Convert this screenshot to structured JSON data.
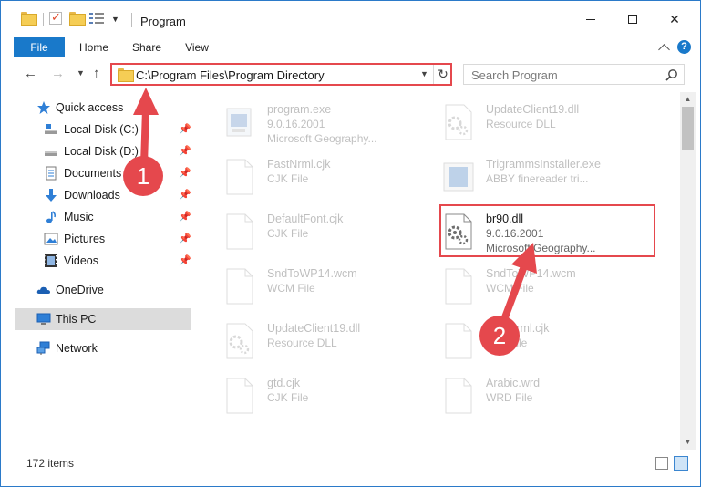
{
  "window": {
    "title": "Program",
    "colors": {
      "accent": "#1979ca",
      "annotation": "#e5484d",
      "selection": "#dcdcdc"
    }
  },
  "ribbon": {
    "tabs": [
      {
        "label": "File"
      },
      {
        "label": "Home"
      },
      {
        "label": "Share"
      },
      {
        "label": "View"
      }
    ]
  },
  "address_bar": {
    "path": "C:\\Program Files\\Program Directory"
  },
  "search": {
    "placeholder": "Search Program"
  },
  "nav_pane": {
    "quick_access": {
      "label": "Quick access",
      "icon": "star-icon"
    },
    "items": [
      {
        "label": "Local Disk (C:)",
        "icon": "drive-icon",
        "pinned": true
      },
      {
        "label": "Local Disk (D:)",
        "icon": "drive-icon",
        "pinned": true
      },
      {
        "label": "Documents",
        "icon": "documents-icon",
        "pinned": true
      },
      {
        "label": "Downloads",
        "icon": "download-icon",
        "pinned": true
      },
      {
        "label": "Music",
        "icon": "music-icon",
        "pinned": true
      },
      {
        "label": "Pictures",
        "icon": "pictures-icon",
        "pinned": true
      },
      {
        "label": "Videos",
        "icon": "videos-icon",
        "pinned": true
      }
    ],
    "onedrive": {
      "label": "OneDrive",
      "icon": "cloud-icon"
    },
    "this_pc": {
      "label": "This PC",
      "icon": "computer-icon",
      "selected": true
    },
    "network": {
      "label": "Network",
      "icon": "network-icon"
    }
  },
  "files": [
    {
      "name": "program.exe",
      "type": "9.0.16.2001",
      "desc": "Microsoft Geography...",
      "icon": "exe-icon",
      "faded": true
    },
    {
      "name": "UpdateClient19.dll",
      "type": "Resource DLL",
      "desc": "",
      "icon": "dll-icon",
      "faded": true
    },
    {
      "name": "FastNrml.cjk",
      "type": "CJK File",
      "desc": "",
      "icon": "file-icon",
      "faded": true
    },
    {
      "name": "TrigrammsInstaller.exe",
      "type": "ABBY finereader tri...",
      "desc": "",
      "icon": "installer-icon",
      "faded": true
    },
    {
      "name": "DefaultFont.cjk",
      "type": "CJK File",
      "desc": "",
      "icon": "file-icon",
      "faded": true
    },
    {
      "name": "br90.dll",
      "type": "9.0.16.2001",
      "desc": "Microsoft Geography...",
      "icon": "dll-icon",
      "faded": false,
      "highlighted": true
    },
    {
      "name": "SndToWP14.wcm",
      "type": "WCM File",
      "desc": "",
      "icon": "file-icon",
      "faded": true
    },
    {
      "name": "SndToWP14.wcm",
      "type": "WCM File",
      "desc": "",
      "icon": "file-icon",
      "faded": true
    },
    {
      "name": "UpdateClient19.dll",
      "type": "Resource DLL",
      "desc": "",
      "icon": "dll-icon",
      "faded": true
    },
    {
      "name": "FastNrml.cjk",
      "type": "CJK File",
      "desc": "",
      "icon": "file-icon",
      "faded": true
    },
    {
      "name": "gtd.cjk",
      "type": "CJK File",
      "desc": "",
      "icon": "file-icon",
      "faded": true
    },
    {
      "name": "Arabic.wrd",
      "type": "WRD File",
      "desc": "",
      "icon": "file-icon",
      "faded": true
    }
  ],
  "status_bar": {
    "item_count": "172 items"
  },
  "annotations": [
    {
      "label": "1"
    },
    {
      "label": "2"
    }
  ]
}
